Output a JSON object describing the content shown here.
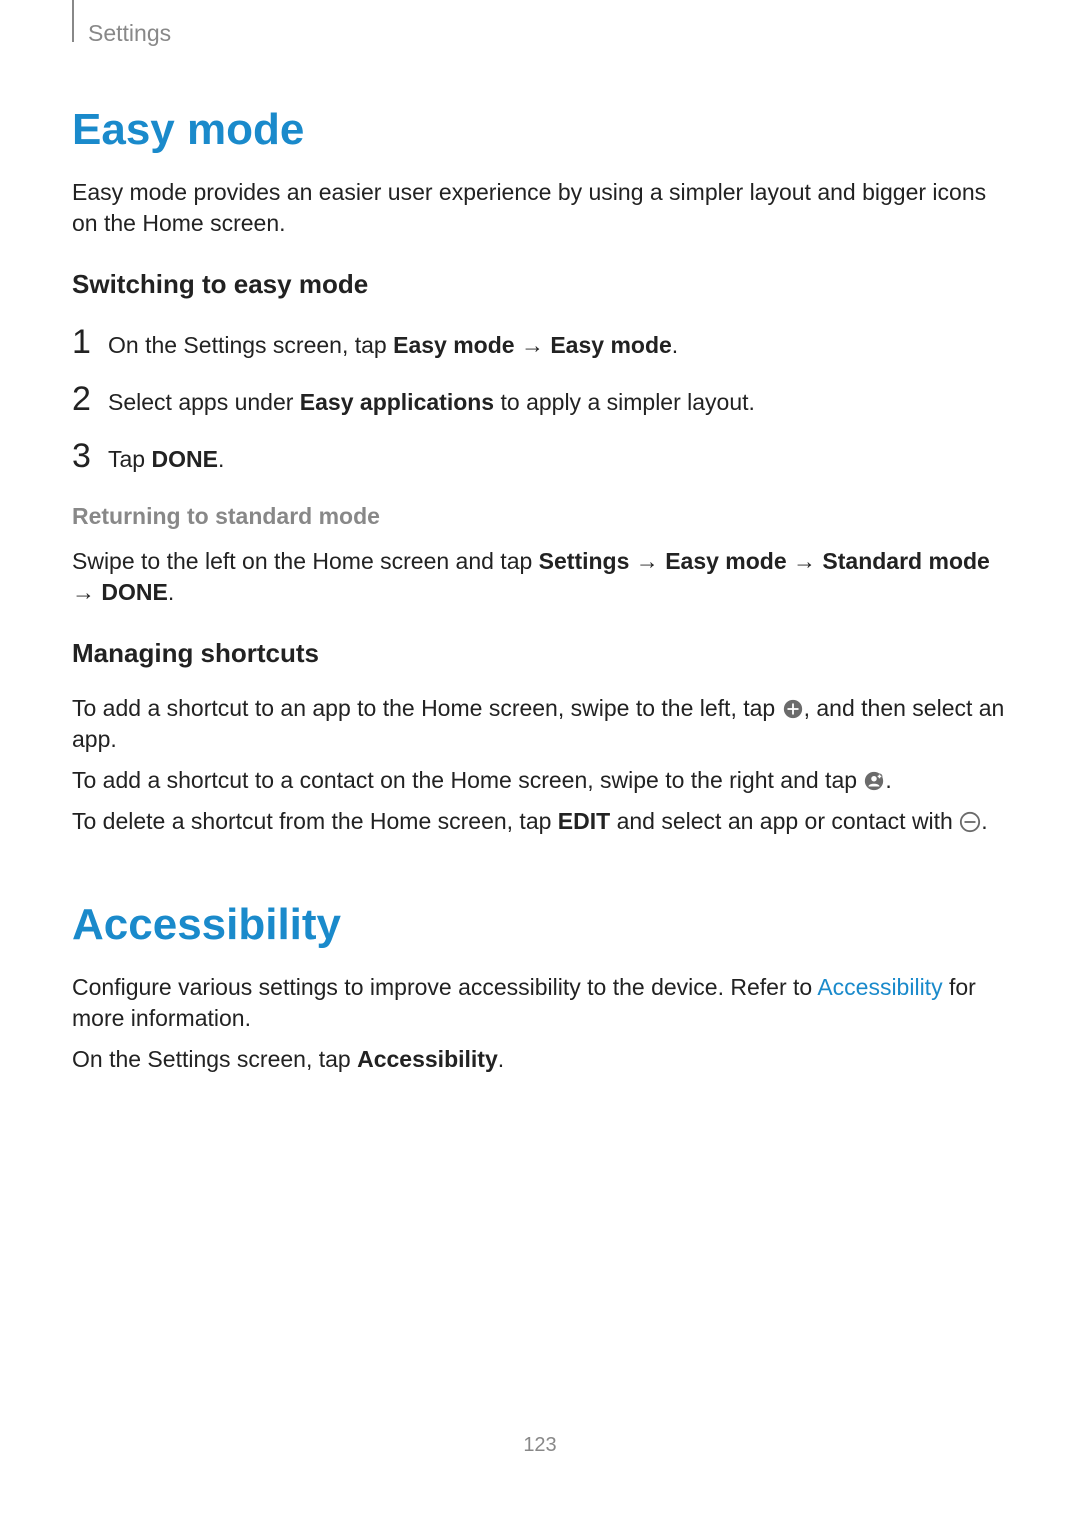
{
  "breadcrumb": "Settings",
  "page_number": "123",
  "easy_mode": {
    "title": "Easy mode",
    "intro": "Easy mode provides an easier user experience by using a simpler layout and bigger icons on the Home screen.",
    "switching": {
      "heading": "Switching to easy mode",
      "steps": {
        "s1_a": "On the Settings screen, tap ",
        "s1_b": "Easy mode",
        "s1_arrow": " → ",
        "s1_c": "Easy mode",
        "s1_d": ".",
        "s2_a": "Select apps under ",
        "s2_b": "Easy applications",
        "s2_c": " to apply a simpler layout.",
        "s3_a": "Tap ",
        "s3_b": "DONE",
        "s3_c": "."
      },
      "num1": "1",
      "num2": "2",
      "num3": "3"
    },
    "returning": {
      "heading": "Returning to standard mode",
      "p_a": "Swipe to the left on the Home screen and tap ",
      "p_b": "Settings",
      "p_arr1": " → ",
      "p_c": "Easy mode",
      "p_arr2": " → ",
      "p_d": "Standard mode",
      "p_arr3": " → ",
      "p_e": "DONE",
      "p_f": "."
    },
    "managing": {
      "heading": "Managing shortcuts",
      "p1_a": "To add a shortcut to an app to the Home screen, swipe to the left, tap ",
      "p1_b": ", and then select an app.",
      "p2_a": "To add a shortcut to a contact on the Home screen, swipe to the right and tap ",
      "p2_b": ".",
      "p3_a": "To delete a shortcut from the Home screen, tap ",
      "p3_b": "EDIT",
      "p3_c": " and select an app or contact with ",
      "p3_d": "."
    }
  },
  "accessibility": {
    "title": "Accessibility",
    "p1_a": "Configure various settings to improve accessibility to the device. Refer to ",
    "p1_link": "Accessibility",
    "p1_b": " for more information.",
    "p2_a": "On the Settings screen, tap ",
    "p2_b": "Accessibility",
    "p2_c": "."
  }
}
